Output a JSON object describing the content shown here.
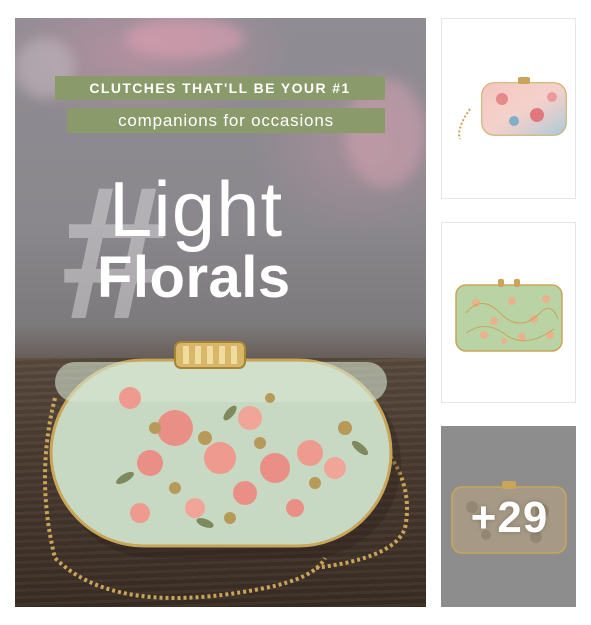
{
  "hero": {
    "banner_line_1": "CLUTCHES THAT'LL BE YOUR #1",
    "banner_line_2": "companions for occasions",
    "hash_symbol": "#",
    "title_line_1": "Light",
    "title_line_2": "Florals",
    "accent_color": "#8a9a6a",
    "clutch_color": "#c7d9c2"
  },
  "gallery": {
    "tiles": [
      {
        "label": "pink-blue-floral-clutch",
        "color": "#f0c9c4"
      },
      {
        "label": "green-floral-clutch",
        "color": "#b9d3a5"
      },
      {
        "label": "grey-embellished-clutch",
        "color": "#a69a86"
      }
    ],
    "more_count": "+29"
  }
}
